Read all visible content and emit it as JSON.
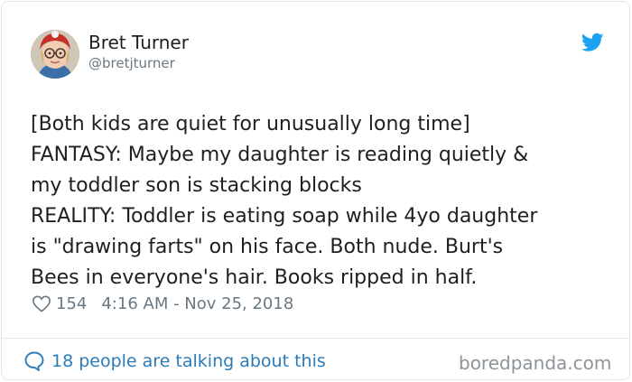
{
  "author": {
    "name": "Bret Turner",
    "handle": "@bretjturner",
    "avatar_icon": "child-avatar"
  },
  "logo_icon": "twitter-bird-icon",
  "brand_color": "#1da1f2",
  "tweet": {
    "lines": [
      "[Both kids are quiet for unusually long time]",
      "FANTASY: Maybe my daughter is reading quietly &",
      "my toddler son is stacking blocks",
      "REALITY: Toddler is eating soap while 4yo daughter",
      "is \"drawing farts\" on his face. Both nude. Burt's",
      "Bees in everyone's hair. Books ripped in half."
    ]
  },
  "meta": {
    "like_icon": "heart-icon",
    "likes": "154",
    "timestamp": "4:16 AM - Nov 25, 2018"
  },
  "footer": {
    "comment_icon": "speech-bubble-icon",
    "talking_label": "18 people are talking about this",
    "link_color": "#2b7bb9",
    "watermark": "boredpanda.com"
  }
}
